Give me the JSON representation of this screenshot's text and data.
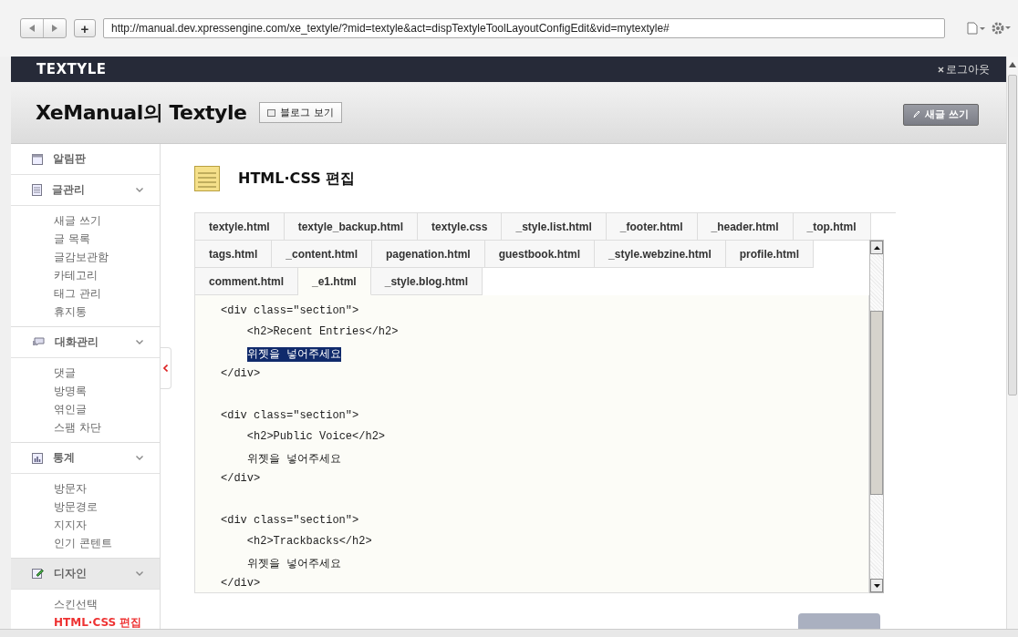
{
  "browser": {
    "new_tab": "+",
    "url": "http://manual.dev.xpressengine.com/xe_textyle/?mid=textyle&act=dispTextyleToolLayoutConfigEdit&vid=mytextyle#"
  },
  "topbar": {
    "logo": "TEXTYLE",
    "logout": "로그아웃"
  },
  "header": {
    "title": "XeManual의 Textyle",
    "view_blog_button": "블로그 보기",
    "write_button": "새글 쓰기"
  },
  "sidebar": {
    "groups": [
      {
        "label": "알림판",
        "expandable": false,
        "selected": false
      },
      {
        "label": "글관리",
        "expandable": true,
        "selected": false,
        "items": [
          {
            "label": "새글 쓰기",
            "selected": false
          },
          {
            "label": "글 목록",
            "selected": false
          },
          {
            "label": "글감보관함",
            "selected": false
          },
          {
            "label": "카테고리",
            "selected": false
          },
          {
            "label": "태그 관리",
            "selected": false
          },
          {
            "label": "휴지통",
            "selected": false
          }
        ]
      },
      {
        "label": "대화관리",
        "expandable": true,
        "selected": false,
        "items": [
          {
            "label": "댓글",
            "selected": false
          },
          {
            "label": "방명록",
            "selected": false
          },
          {
            "label": "엮인글",
            "selected": false
          },
          {
            "label": "스팸 차단",
            "selected": false
          }
        ]
      },
      {
        "label": "통계",
        "expandable": true,
        "selected": false,
        "items": [
          {
            "label": "방문자",
            "selected": false
          },
          {
            "label": "방문경로",
            "selected": false
          },
          {
            "label": "지지자",
            "selected": false
          },
          {
            "label": "인기 콘텐트",
            "selected": false
          }
        ]
      },
      {
        "label": "디자인",
        "expandable": true,
        "selected": true,
        "items": [
          {
            "label": "스킨선택",
            "selected": false
          },
          {
            "label": "HTML·CSS 편집",
            "selected": true
          }
        ]
      }
    ]
  },
  "page": {
    "title": "HTML·CSS 편집",
    "tabs": [
      {
        "label": "textyle.html",
        "selected": false
      },
      {
        "label": "textyle_backup.html",
        "selected": false
      },
      {
        "label": "textyle.css",
        "selected": false
      },
      {
        "label": "_style.list.html",
        "selected": false
      },
      {
        "label": "_footer.html",
        "selected": false
      },
      {
        "label": "_header.html",
        "selected": false
      },
      {
        "label": "_top.html",
        "selected": false
      },
      {
        "label": "tags.html",
        "selected": false
      },
      {
        "label": "_content.html",
        "selected": false
      },
      {
        "label": "pagenation.html",
        "selected": false
      },
      {
        "label": "guestbook.html",
        "selected": false
      },
      {
        "label": "_style.webzine.html",
        "selected": false
      },
      {
        "label": "profile.html",
        "selected": false
      },
      {
        "label": "comment.html",
        "selected": false
      },
      {
        "label": "_e1.html",
        "selected": true
      },
      {
        "label": "_style.blog.html",
        "selected": false
      }
    ],
    "code_blocks": [
      {
        "lines": [
          {
            "text": "<div class=\"section\">",
            "selected": false
          },
          {
            "text": "    <h2>Recent Entries</h2>",
            "selected": false
          },
          {
            "text": "    위젯을 넣어주세요",
            "selected": true
          },
          {
            "text": "</div>",
            "selected": false
          }
        ]
      },
      {
        "lines": [
          {
            "text": "<div class=\"section\">",
            "selected": false
          },
          {
            "text": "    <h2>Public Voice</h2>",
            "selected": false
          },
          {
            "text": "    위젯을 넣어주세요",
            "selected": false
          },
          {
            "text": "</div>",
            "selected": false
          }
        ]
      },
      {
        "lines": [
          {
            "text": "<div class=\"section\">",
            "selected": false
          },
          {
            "text": "    <h2>Trackbacks</h2>",
            "selected": false
          },
          {
            "text": "    위젯을 넣어주세요",
            "selected": false
          },
          {
            "text": "</div>",
            "selected": false
          }
        ]
      }
    ]
  }
}
